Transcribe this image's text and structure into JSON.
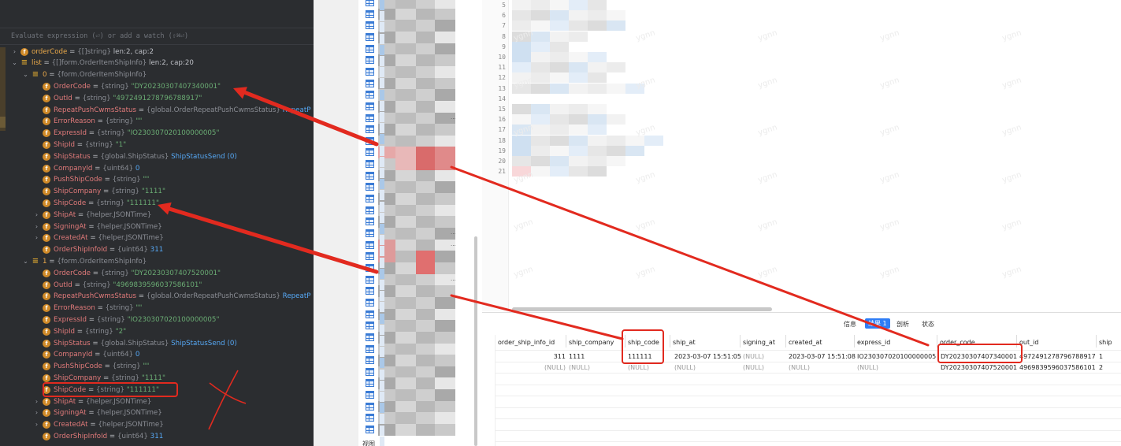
{
  "debugger": {
    "eval_placeholder": "Evaluate expression (⏎) or add a watch (⇧⌘⏎)",
    "rows": [
      {
        "indent": 0,
        "arrow": "›",
        "icon": "f",
        "name": "orderCode",
        "type": "{[]string}",
        "value": "len:2, cap:2",
        "vclass": "plain",
        "nameClass": "orange"
      },
      {
        "indent": 0,
        "arrow": "⌄",
        "icon": "list",
        "name": "list",
        "type": "{[]form.OrderItemShipInfo}",
        "value": "len:2, cap:20",
        "vclass": "plain",
        "nameClass": "orange"
      },
      {
        "indent": 1,
        "arrow": "⌄",
        "icon": "list",
        "name": "0",
        "type": "{form.OrderItemShipInfo}",
        "value": "",
        "vclass": "plain",
        "nameClass": "orange"
      },
      {
        "indent": 2,
        "arrow": "",
        "icon": "f",
        "name": "OrderCode",
        "type": "{string}",
        "value": "\"DY20230307407340001\"",
        "vclass": "str"
      },
      {
        "indent": 2,
        "arrow": "",
        "icon": "f",
        "name": "OutId",
        "type": "{string}",
        "value": "\"4972491278796788917\"",
        "vclass": "str"
      },
      {
        "indent": 2,
        "arrow": "",
        "icon": "f",
        "name": "RepeatPushCwmsStatus",
        "type": "{global.OrderRepeatPushCwmsStatus}",
        "value": "RepeatP",
        "vclass": "enum"
      },
      {
        "indent": 2,
        "arrow": "",
        "icon": "f",
        "name": "ErrorReason",
        "type": "{string}",
        "value": "\"\"",
        "vclass": "str"
      },
      {
        "indent": 2,
        "arrow": "",
        "icon": "f",
        "name": "ExpressId",
        "type": "{string}",
        "value": "\"IO230307020100000005\"",
        "vclass": "str"
      },
      {
        "indent": 2,
        "arrow": "",
        "icon": "f",
        "name": "ShipId",
        "type": "{string}",
        "value": "\"1\"",
        "vclass": "str"
      },
      {
        "indent": 2,
        "arrow": "",
        "icon": "f",
        "name": "ShipStatus",
        "type": "{global.ShipStatus}",
        "value": "ShipStatusSend (0)",
        "vclass": "enum"
      },
      {
        "indent": 2,
        "arrow": "",
        "icon": "f",
        "name": "CompanyId",
        "type": "{uint64}",
        "value": "0",
        "vclass": "num"
      },
      {
        "indent": 2,
        "arrow": "",
        "icon": "f",
        "name": "PushShipCode",
        "type": "{string}",
        "value": "\"\"",
        "vclass": "str"
      },
      {
        "indent": 2,
        "arrow": "",
        "icon": "f",
        "name": "ShipCompany",
        "type": "{string}",
        "value": "\"1111\"",
        "vclass": "str"
      },
      {
        "indent": 2,
        "arrow": "",
        "icon": "f",
        "name": "ShipCode",
        "type": "{string}",
        "value": "\"111111\"",
        "vclass": "str"
      },
      {
        "indent": 2,
        "arrow": "›",
        "icon": "f",
        "name": "ShipAt",
        "type": "{helper.JSONTime}",
        "value": "",
        "vclass": "plain"
      },
      {
        "indent": 2,
        "arrow": "›",
        "icon": "f",
        "name": "SigningAt",
        "type": "{helper.JSONTime}",
        "value": "",
        "vclass": "plain"
      },
      {
        "indent": 2,
        "arrow": "›",
        "icon": "f",
        "name": "CreatedAt",
        "type": "{helper.JSONTime}",
        "value": "",
        "vclass": "plain"
      },
      {
        "indent": 2,
        "arrow": "",
        "icon": "f",
        "name": "OrderShipInfoId",
        "type": "{uint64}",
        "value": "311",
        "vclass": "num"
      },
      {
        "indent": 1,
        "arrow": "⌄",
        "icon": "list",
        "name": "1",
        "type": "{form.OrderItemShipInfo}",
        "value": "",
        "vclass": "plain",
        "nameClass": "orange"
      },
      {
        "indent": 2,
        "arrow": "",
        "icon": "f",
        "name": "OrderCode",
        "type": "{string}",
        "value": "\"DY20230307407520001\"",
        "vclass": "str"
      },
      {
        "indent": 2,
        "arrow": "",
        "icon": "f",
        "name": "OutId",
        "type": "{string}",
        "value": "\"4969839596037586101\"",
        "vclass": "str"
      },
      {
        "indent": 2,
        "arrow": "",
        "icon": "f",
        "name": "RepeatPushCwmsStatus",
        "type": "{global.OrderRepeatPushCwmsStatus}",
        "value": "RepeatP",
        "vclass": "enum"
      },
      {
        "indent": 2,
        "arrow": "",
        "icon": "f",
        "name": "ErrorReason",
        "type": "{string}",
        "value": "\"\"",
        "vclass": "str"
      },
      {
        "indent": 2,
        "arrow": "",
        "icon": "f",
        "name": "ExpressId",
        "type": "{string}",
        "value": "\"IO230307020100000005\"",
        "vclass": "str"
      },
      {
        "indent": 2,
        "arrow": "",
        "icon": "f",
        "name": "ShipId",
        "type": "{string}",
        "value": "\"2\"",
        "vclass": "str"
      },
      {
        "indent": 2,
        "arrow": "",
        "icon": "f",
        "name": "ShipStatus",
        "type": "{global.ShipStatus}",
        "value": "ShipStatusSend (0)",
        "vclass": "enum"
      },
      {
        "indent": 2,
        "arrow": "",
        "icon": "f",
        "name": "CompanyId",
        "type": "{uint64}",
        "value": "0",
        "vclass": "num"
      },
      {
        "indent": 2,
        "arrow": "",
        "icon": "f",
        "name": "PushShipCode",
        "type": "{string}",
        "value": "\"\"",
        "vclass": "str"
      },
      {
        "indent": 2,
        "arrow": "",
        "icon": "f",
        "name": "ShipCompany",
        "type": "{string}",
        "value": "\"1111\"",
        "vclass": "str"
      },
      {
        "indent": 2,
        "arrow": "",
        "icon": "f",
        "name": "ShipCode",
        "type": "{string}",
        "value": "\"111111\"",
        "vclass": "str"
      },
      {
        "indent": 2,
        "arrow": "›",
        "icon": "f",
        "name": "ShipAt",
        "type": "{helper.JSONTime}",
        "value": "",
        "vclass": "plain"
      },
      {
        "indent": 2,
        "arrow": "›",
        "icon": "f",
        "name": "SigningAt",
        "type": "{helper.JSONTime}",
        "value": "",
        "vclass": "plain"
      },
      {
        "indent": 2,
        "arrow": "›",
        "icon": "f",
        "name": "CreatedAt",
        "type": "{helper.JSONTime}",
        "value": "",
        "vclass": "plain"
      },
      {
        "indent": 2,
        "arrow": "",
        "icon": "f",
        "name": "OrderShipInfoId",
        "type": "{uint64}",
        "value": "311",
        "vclass": "num"
      }
    ]
  },
  "navigator": {
    "bottom_label": "视图",
    "ellipsis": "..."
  },
  "editor": {
    "line_numbers": [
      "5",
      "6",
      "7",
      "8",
      "9",
      "10",
      "11",
      "12",
      "13",
      "14",
      "15",
      "16",
      "17",
      "18",
      "19",
      "20",
      "21"
    ],
    "watermark": "ygnn"
  },
  "results": {
    "tabs": [
      {
        "label": "信息",
        "active": false
      },
      {
        "label": "结果 1",
        "active": true
      },
      {
        "label": "剖析",
        "active": false
      },
      {
        "label": "状态",
        "active": false
      }
    ],
    "columns": [
      "order_ship_info_id",
      "ship_company",
      "ship_code",
      "ship_at",
      "signing_at",
      "created_at",
      "express_id",
      "order_code",
      "out_id",
      "ship"
    ],
    "rows": [
      [
        "311",
        "1111",
        "111111",
        "2023-03-07 15:51:05",
        "(NULL)",
        "2023-03-07 15:51:08",
        "IO230307020100000005",
        "DY20230307407340001",
        "4972491278796788917",
        "1"
      ],
      [
        "(NULL)",
        "(NULL)",
        "(NULL)",
        "(NULL)",
        "(NULL)",
        "(NULL)",
        "(NULL)",
        "DY20230307407520001",
        "4969839596037586101",
        "2"
      ]
    ]
  },
  "annotations": {
    "color": "#e22a1f"
  }
}
